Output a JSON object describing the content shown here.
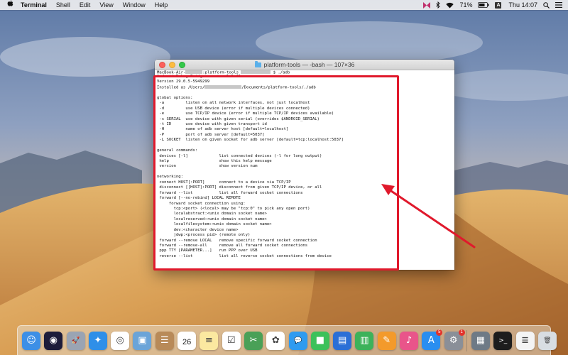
{
  "menubar": {
    "apple_icon": "apple-logo",
    "items": [
      "Terminal",
      "Shell",
      "Edit",
      "View",
      "Window",
      "Help"
    ],
    "battery": "71%",
    "input_source": "A",
    "clock": "Thu 14:07"
  },
  "window": {
    "title": "platform-tools — -bash — 107×36",
    "prompt_host": "MacBook-Air-",
    "prompt_dir": ":platform-tools ",
    "prompt_cmd": "$ ./adb",
    "output_lines": [
      "Android Debug Bridge version 1.0.41",
      "Version 29.0.5-5949299",
      "Installed as /Users/[REDACTED]/Documents/platform-tools/./adb",
      "",
      "global options:",
      " -a         listen on all network interfaces, not just localhost",
      " -d         use USB device (error if multiple devices connected)",
      " -e         use TCP/IP device (error if multiple TCP/IP devices available)",
      " -s SERIAL  use device with given serial (overrides $ANDROID_SERIAL)",
      " -t ID      use device with given transport id",
      " -H         name of adb server host [default=localhost]",
      " -P         port of adb server [default=5037]",
      " -L SOCKET  listen on given socket for adb server [default=tcp:localhost:5037]",
      "",
      "general commands:",
      " devices [-l]             list connected devices (-l for long output)",
      " help                     show this help message",
      " version                  show version num",
      "",
      "networking:",
      " connect HOST[:PORT]      connect to a device via TCP/IP",
      " disconnect [[HOST]:PORT] disconnect from given TCP/IP device, or all",
      " forward --list           list all forward socket connections",
      " forward [--no-rebind] LOCAL REMOTE",
      "     forward socket connection using:",
      "       tcp:<port> (<local> may be \"tcp:0\" to pick any open port)",
      "       localabstract:<unix domain socket name>",
      "       localreserved:<unix domain socket name>",
      "       localfilesystem:<unix domain socket name>",
      "       dev:<character device name>",
      "       jdwp:<process pid> (remote only)",
      " forward --remove LOCAL   remove specific forward socket connection",
      " forward --remove-all     remove all forward socket connections",
      " ppp TTY [PARAMETER...]   run PPP over USB",
      " reverse --list           list all reverse socket connections from device"
    ]
  },
  "colors": {
    "highlight": "#e0192c",
    "arrow": "#e0192c"
  },
  "dock": {
    "icons": [
      {
        "name": "finder-icon",
        "color": "#3d8fe6",
        "glyph": "☺"
      },
      {
        "name": "siri-icon",
        "color": "#1c1c3a",
        "glyph": "◉"
      },
      {
        "name": "launchpad-icon",
        "color": "#9aa4b3",
        "glyph": "🚀"
      },
      {
        "name": "safari-icon",
        "color": "#2f8fe8",
        "glyph": "✦"
      },
      {
        "name": "chrome-icon",
        "color": "#ffffff",
        "glyph": "◎"
      },
      {
        "name": "preview-icon",
        "color": "#6ba4d8",
        "glyph": "▣"
      },
      {
        "name": "contacts-icon",
        "color": "#b88a58",
        "glyph": "☰"
      },
      {
        "name": "calendar-icon",
        "color": "#ffffff",
        "glyph": "26"
      },
      {
        "name": "notes-icon",
        "color": "#fbe8a0",
        "glyph": "≡"
      },
      {
        "name": "reminders-icon",
        "color": "#ffffff",
        "glyph": "☑"
      },
      {
        "name": "photo-booth-icon",
        "color": "#4aa057",
        "glyph": "✂"
      },
      {
        "name": "photos-icon",
        "color": "#ffffff",
        "glyph": "✿"
      },
      {
        "name": "messages-icon",
        "color": "#2f9bf0",
        "glyph": "💬"
      },
      {
        "name": "facetime-icon",
        "color": "#3cc15a",
        "glyph": "■"
      },
      {
        "name": "keynote-icon",
        "color": "#2b6fd6",
        "glyph": "▤"
      },
      {
        "name": "numbers-icon",
        "color": "#3cb25a",
        "glyph": "▥"
      },
      {
        "name": "pages-icon",
        "color": "#f39a2b",
        "glyph": "✎"
      },
      {
        "name": "itunes-icon",
        "color": "#e9558a",
        "glyph": "♪"
      },
      {
        "name": "app-store-icon",
        "color": "#2a8ef0",
        "glyph": "A",
        "badge": "5"
      },
      {
        "name": "system-preferences-icon",
        "color": "#8a8f98",
        "glyph": "⚙",
        "badge": "1"
      },
      {
        "name": "utility-icon",
        "color": "#6e7a86",
        "glyph": "▦"
      },
      {
        "name": "terminal-icon",
        "color": "#1d1d1d",
        "glyph": ">_"
      },
      {
        "name": "document-icon",
        "color": "#f4f4f4",
        "glyph": "≣"
      },
      {
        "name": "trash-icon",
        "color": "#d8dde2",
        "glyph": "🗑"
      }
    ],
    "calendar_day": "26"
  }
}
